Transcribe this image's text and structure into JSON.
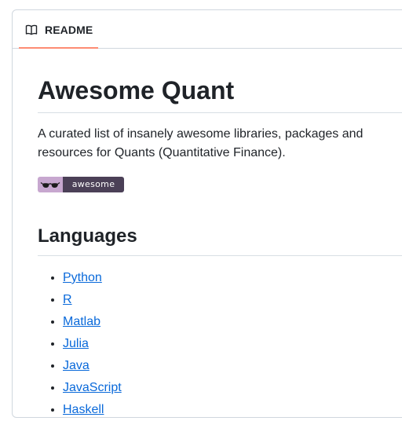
{
  "readme_tab": {
    "label": "README",
    "icon": "book-icon",
    "underline_color": "#fd8c73"
  },
  "readme": {
    "title": "Awesome Quant",
    "description": "A curated list of insanely awesome libraries, packages and resources for Quants (Quantitative Finance).",
    "badge": {
      "icon": "sunglasses-icon",
      "text": "awesome",
      "left_color": "#c7a7cf",
      "right_color": "#4b4057"
    },
    "languages_heading": "Languages",
    "languages": [
      "Python",
      "R",
      "Matlab",
      "Julia",
      "Java",
      "JavaScript",
      "Haskell"
    ]
  },
  "colors": {
    "link": "#0969da",
    "text": "#1f2328",
    "border": "#d0d7de"
  }
}
